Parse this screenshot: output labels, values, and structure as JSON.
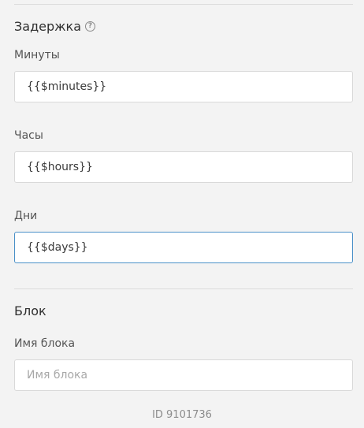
{
  "delay_section": {
    "title": "Задержка",
    "help_icon": "question-circle-icon",
    "fields": [
      {
        "label": "Минуты",
        "value": "{{$minutes}}"
      },
      {
        "label": "Часы",
        "value": "{{$hours}}"
      },
      {
        "label": "Дни",
        "value": "{{$days}}"
      }
    ]
  },
  "block_section": {
    "title": "Блок",
    "name_label": "Имя блока",
    "name_value": "",
    "name_placeholder": "Имя блока"
  },
  "footer": {
    "id_text": "ID 9101736"
  },
  "colors": {
    "background": "#f3f3f3",
    "input_border": "#d9d9d9",
    "focus_border": "#4a90c8"
  }
}
